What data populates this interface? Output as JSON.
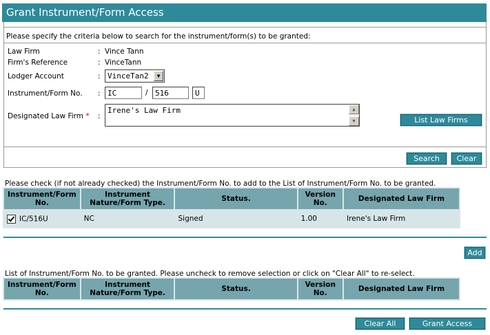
{
  "page": {
    "title": "Grant Instrument/Form Access",
    "instructions": "Please specify the criteria below to search for the instrument/form(s) to be granted:"
  },
  "form": {
    "law_firm_label": "Law Firm",
    "law_firm_value": "Vince Tann",
    "firm_reference_label": "Firm's Reference",
    "firm_reference_value": "VinceTann",
    "lodger_account_label": "Lodger Account",
    "lodger_account_value": "VinceTan2",
    "instrument_no_label": "Instrument/Form No.",
    "instrument_prefix": "IC",
    "instrument_separator": "/",
    "instrument_number": "516",
    "instrument_suffix": "U",
    "designated_label": "Designated Law Firm",
    "required_mark": "*",
    "colon": ":",
    "designated_value": "Irene's Law Firm"
  },
  "buttons": {
    "list_law_firms": "List Law Firms",
    "search": "Search",
    "clear": "Clear",
    "add": "Add",
    "clear_all": "Clear All",
    "grant_access": "Grant Access"
  },
  "results": {
    "instruction": "Please check (if not already checked) the Instrument/Form No. to add to the List of Instrument/Form No. to be granted.",
    "columns": [
      "Instrument/Form No.",
      "Instrument Nature/Form Type.",
      "Status.",
      "Version No.",
      "Designated Law Firm"
    ],
    "rows": [
      {
        "checked": true,
        "instrument": "IC/516U",
        "nature": "NC",
        "status": "Signed",
        "version": "1.00",
        "firm": "Irene's Law Firm"
      }
    ]
  },
  "granted": {
    "instruction": "List of Instrument/Form No. to be granted. Please uncheck to remove selection or click on \"Clear All\" to re-select.",
    "columns": [
      "Instrument/Form No.",
      "Instrument Nature/Form Type.",
      "Status.",
      "Version No.",
      "Designated Law Firm"
    ]
  },
  "colors": {
    "accent": "#2e8a9a",
    "header_cell": "#76a5ad",
    "row_cell": "#d7e5e8"
  }
}
